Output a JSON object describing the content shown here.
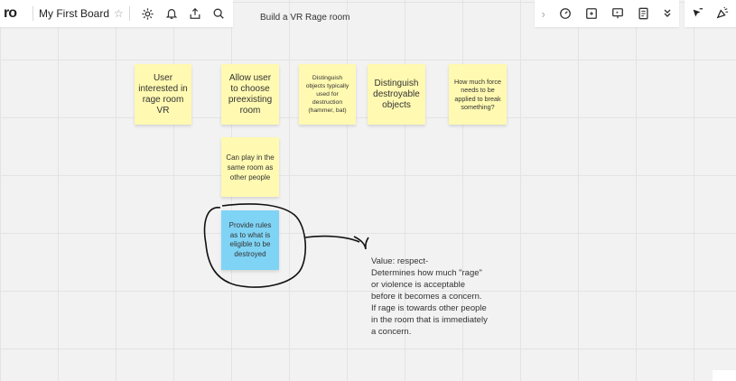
{
  "app": {
    "logo": "ro",
    "board_name": "My First Board",
    "frame_title": "Build a VR Rage room"
  },
  "toolbar_left": {
    "icons": [
      "settings-icon",
      "bell-icon",
      "share-icon",
      "search-icon"
    ]
  },
  "toolbar_right": {
    "icons": [
      "chevron-right-icon",
      "timer-icon",
      "screen-add-icon",
      "present-icon",
      "notes-icon",
      "double-chevron-icon",
      "cursor-icon",
      "reaction-icon"
    ]
  },
  "notes": [
    {
      "id": "n1",
      "text": "User interested in rage room VR",
      "color": "#fff9b1"
    },
    {
      "id": "n2",
      "text": "Allow user to choose preexisting room",
      "color": "#fff9b1"
    },
    {
      "id": "n3",
      "text": "Distinguish objects typically used for destruction (hammer, bat)",
      "color": "#fff9b1"
    },
    {
      "id": "n4",
      "text": "Distinguish destroyable objects",
      "color": "#fff9b1"
    },
    {
      "id": "n5",
      "text": "How much force needs to be applied to break something?",
      "color": "#fff9b1"
    },
    {
      "id": "n6",
      "text": "Can play in the same room as other people",
      "color": "#fff9b1"
    },
    {
      "id": "n7",
      "text": "Provide rules as to what is eligible to be destroyed",
      "color": "#7fd4f5"
    }
  ],
  "annotation": "Value: respect-\nDetermines how much \"rage\"\nor violence is acceptable\nbefore it becomes a concern.\nIf rage is towards other people\nin the room that is immediately\na concern."
}
